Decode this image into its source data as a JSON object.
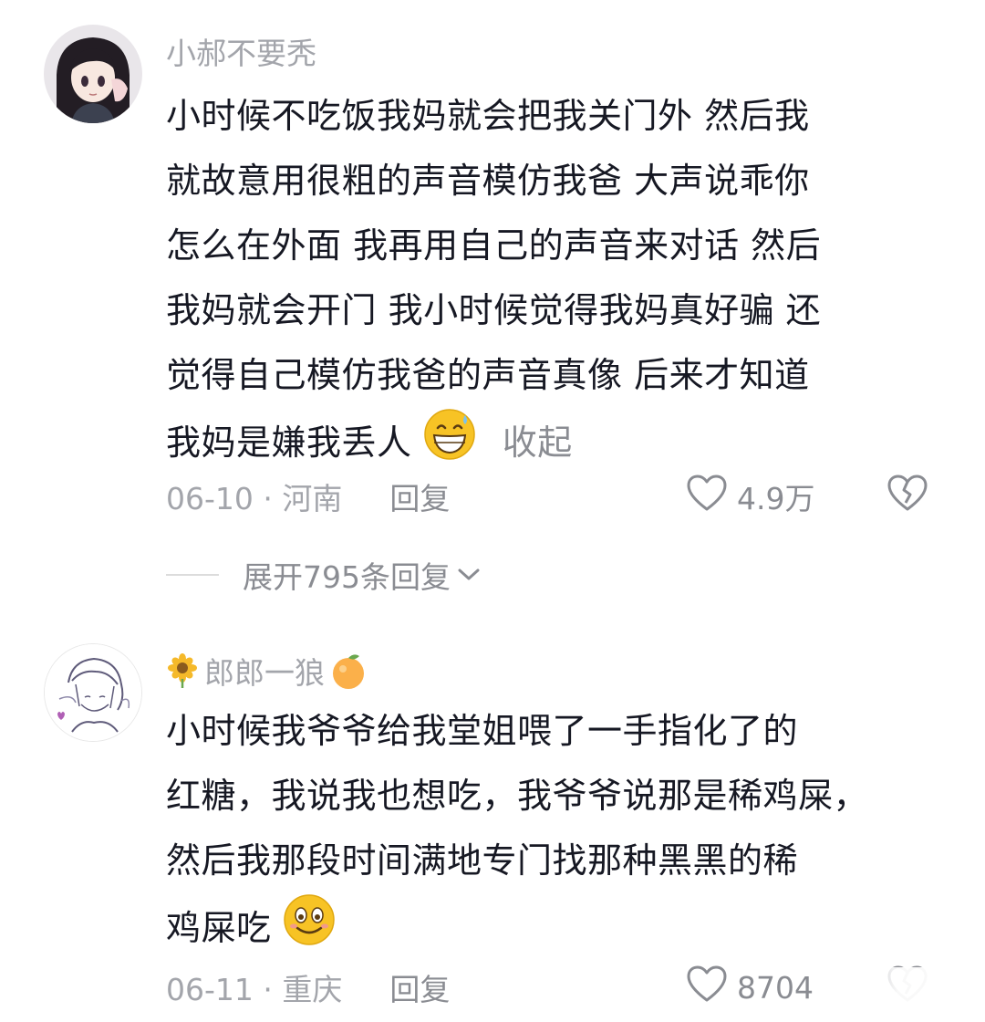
{
  "comments": [
    {
      "username": "小郝不要秃",
      "content_lines": [
        "小时候不吃饭我妈就会把我关门外 然后我",
        "就故意用很粗的声音模仿我爸 大声说乖你",
        "怎么在外面 我再用自己的声音来对话 然后",
        "我妈就会开门 我小时候觉得我妈真好骗 还",
        "觉得自己模仿我爸的声音真像 后来才知道",
        "我妈是嫌我丢人"
      ],
      "emoji": "grinning-sweat-emoji",
      "collapse_label": "收起",
      "date_location": "06-10 · 河南",
      "reply_label": "回复",
      "like_count": "4.9万",
      "expand_replies_label": "展开795条回复"
    },
    {
      "username": "郎郎一狼",
      "username_prefix_icon": "sunflower-icon",
      "username_suffix_icon": "orange-icon",
      "content_lines": [
        "小时候我爷爷给我堂姐喂了一手指化了的",
        "红糖，我说我也想吃，我爷爷说那是稀鸡屎，",
        "然后我那段时间满地专门找那种黑黑的稀",
        "鸡屎吃"
      ],
      "emoji": "smiling-emoji",
      "date_location": "06-11 · 重庆",
      "reply_label": "回复",
      "like_count": "8704"
    }
  ],
  "colors": {
    "primary_text": "#161823",
    "secondary_text": "#a3a5ab",
    "emoji_yellow": "#f7c325"
  }
}
